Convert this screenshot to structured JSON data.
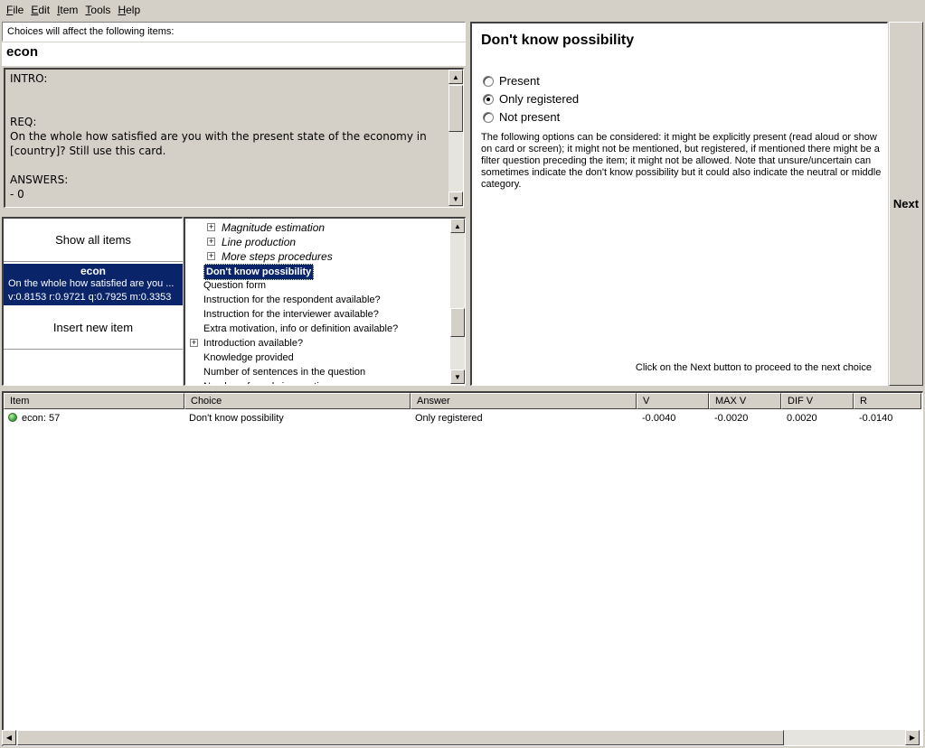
{
  "menu": [
    {
      "label": "File",
      "underline": "F",
      "rest": "ile"
    },
    {
      "label": "Edit",
      "underline": "E",
      "rest": "dit"
    },
    {
      "label": "Item",
      "underline": "I",
      "rest": "tem"
    },
    {
      "label": "Tools",
      "underline": "T",
      "rest": "ools"
    },
    {
      "label": "Help",
      "underline": "H",
      "rest": "elp"
    }
  ],
  "top_left": {
    "affect_label": "Choices will affect the following items:",
    "item_name": "econ",
    "item_text": "INTRO:\n\n\nREQ:\nOn the whole how satisfied are you with the present state of the economy in [country]? Still use this card.\n\nANSWERS:\n- 0"
  },
  "left_list": {
    "show_all": "Show all items",
    "insert_new": "Insert new item",
    "selected_item": {
      "title": "econ",
      "desc": "On the whole how satisfied are you ...",
      "stats": "v:0.8153 r:0.9721 q:0.7925 m:0.3353"
    }
  },
  "tree": {
    "nodes": [
      {
        "label": "Magnitude estimation",
        "expandable": true,
        "italic": true
      },
      {
        "label": "Line production",
        "expandable": true,
        "italic": true
      },
      {
        "label": "More steps procedures",
        "expandable": true,
        "italic": true
      },
      {
        "label": "Don't know possibility",
        "selected": true
      },
      {
        "label": "Question form"
      },
      {
        "label": "Instruction for the respondent available?"
      },
      {
        "label": "Instruction for the interviewer available?"
      },
      {
        "label": "Extra motivation, info or definition available?"
      },
      {
        "label": "Introduction available?",
        "expandable": true
      },
      {
        "label": "Knowledge provided"
      },
      {
        "label": "Number of sentences in the question"
      },
      {
        "label": "Number of words in question"
      }
    ]
  },
  "choice_panel": {
    "title": "Don't know possibility",
    "options": [
      {
        "label": "Present",
        "checked": false
      },
      {
        "label": "Only registered",
        "checked": true
      },
      {
        "label": "Not present",
        "checked": false
      }
    ],
    "description": "The following options can be considered: it might be explicitly present (read aloud or show on card or screen); it might not be mentioned, but registered, if mentioned there might be a filter question preceding the item; it might not be allowed. Note that unsure/uncertain can sometimes indicate the don't know possibility but it could also indicate the neutral or middle category.",
    "hint": "Click on the Next button to proceed to the next choice",
    "next_label": "Next"
  },
  "results": {
    "columns": [
      "Item",
      "Choice",
      "Answer",
      "V",
      "MAX V",
      "DIF V",
      "R"
    ],
    "rows": [
      {
        "item": "econ: 57",
        "choice": "Don't know possibility",
        "answer": "Only registered",
        "v": "-0.0040",
        "max_v": "-0.0020",
        "dif_v": "0.0020",
        "r": "-0.0140",
        "status_color": "#2f9a2f"
      }
    ]
  },
  "colors": {
    "selection": "#0a246a",
    "window": "#d4d0c8"
  }
}
